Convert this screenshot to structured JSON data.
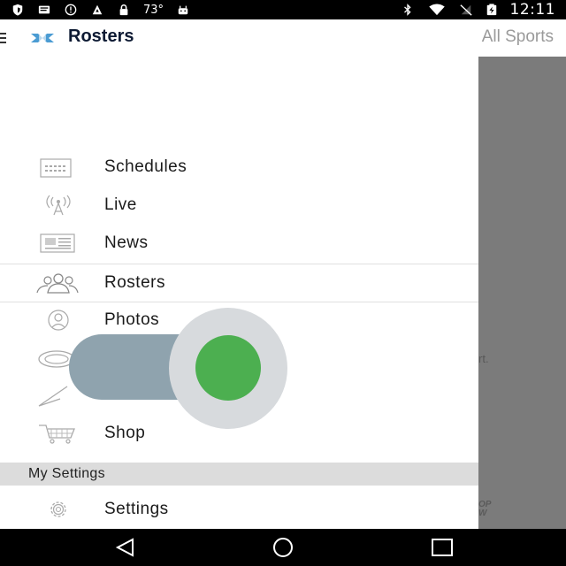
{
  "status_bar": {
    "temperature": "73°",
    "time": "12:11",
    "icons": [
      "shield-icon",
      "message-icon",
      "alert-icon",
      "app-icon",
      "lock-icon",
      "android-icon",
      "bluetooth-icon",
      "wifi-icon",
      "no-sim-icon",
      "battery-charging-icon"
    ]
  },
  "app_bar": {
    "title": "Rosters",
    "right_title": "All Sports",
    "logo_icon": "unc-logo"
  },
  "drawer": {
    "items": [
      {
        "label": "Schedules",
        "icon": "calendar-icon"
      },
      {
        "label": "Live",
        "icon": "broadcast-icon"
      },
      {
        "label": "News",
        "icon": "newspaper-icon"
      },
      {
        "label": "Rosters",
        "icon": "people-icon",
        "active": true
      },
      {
        "label": "Photos",
        "icon": "camera-icon"
      },
      {
        "label": "",
        "icon": "venue-icon"
      },
      {
        "label": "",
        "icon": "social-icon"
      },
      {
        "label": "Shop",
        "icon": "cart-icon"
      }
    ],
    "section_header": "My Settings",
    "settings_item": {
      "label": "Settings",
      "icon": "gear-icon"
    }
  },
  "overlay": {
    "ghost_text_1": "rt.",
    "ghost_text_2": "OP\nW"
  },
  "toggle": {
    "state": "on",
    "thumb_color": "#4caf50",
    "track_color": "#8fa3ae"
  },
  "colors": {
    "title": "#0d1a33",
    "unc_blue": "#4b9cd3",
    "section_bg": "#dcdcdc",
    "overlay": "#7b7b7b"
  },
  "nav_bar": {
    "buttons": [
      "back-icon",
      "home-icon",
      "recents-icon"
    ]
  }
}
